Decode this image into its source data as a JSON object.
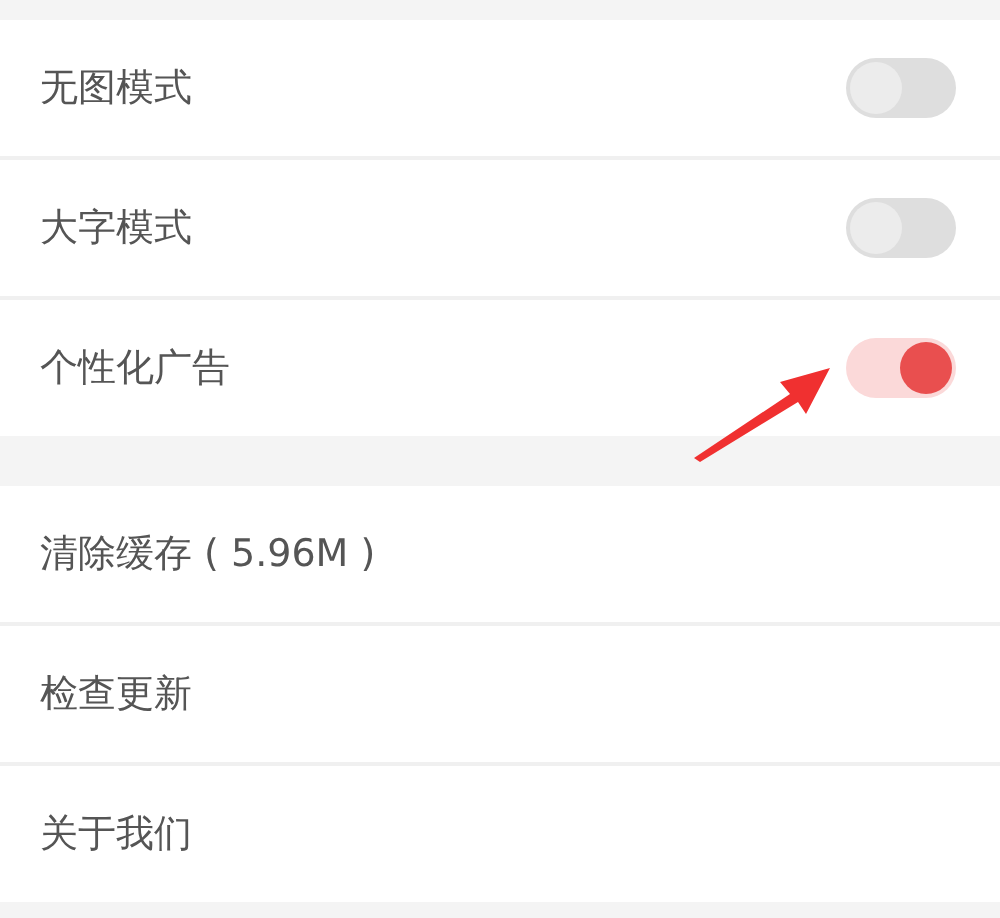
{
  "groups": [
    {
      "items": [
        {
          "kind": "toggle",
          "label": "无图模式",
          "on": false
        },
        {
          "kind": "toggle",
          "label": "大字模式",
          "on": false
        },
        {
          "kind": "toggle",
          "label": "个性化广告",
          "on": true
        }
      ]
    },
    {
      "items": [
        {
          "kind": "link",
          "label": "清除缓存 ( 5.96M )"
        },
        {
          "kind": "link",
          "label": "检查更新"
        },
        {
          "kind": "link",
          "label": "关于我们"
        }
      ]
    }
  ],
  "annotation": {
    "kind": "arrow"
  }
}
